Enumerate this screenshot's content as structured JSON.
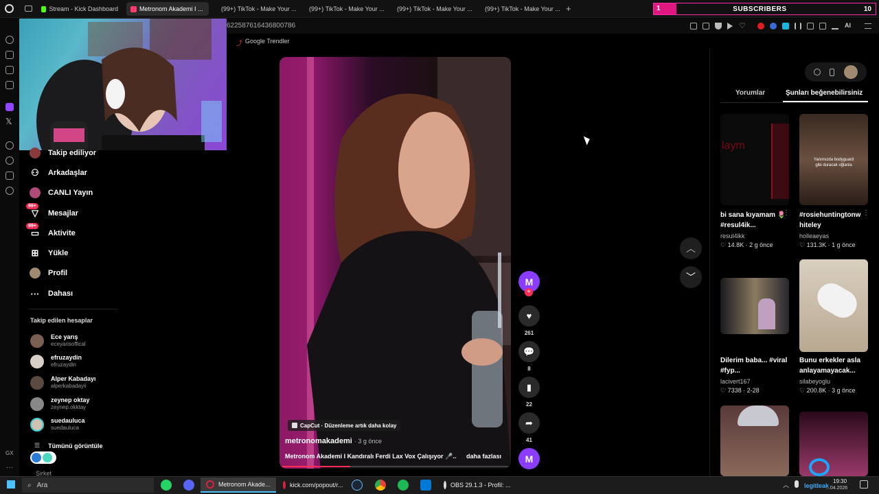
{
  "browser": {
    "tabs": [
      {
        "label": "Stream - Kick Dashboard",
        "color": "#53fc18"
      },
      {
        "label": "Metronom Akademi I ...",
        "color": "#ff3c6e",
        "active": true
      },
      {
        "label": "(99+) TikTok - Make Your ...",
        "color": "#ffffff"
      },
      {
        "label": "(99+) TikTok - Make Your ...",
        "color": "#ffffff"
      },
      {
        "label": "(99+) TikTok - Make Your ...",
        "color": "#ffffff"
      },
      {
        "label": "(99+) TikTok - Make Your ...",
        "color": "#ffffff"
      }
    ],
    "new_tab": "+",
    "url_fragment": "622587616436800786",
    "ai_label": "AI"
  },
  "subscribers_widget": {
    "count": "1",
    "label": "SUBSCRIBERS",
    "goal": "10",
    "progress": 0.1,
    "bar_color": "#e0177e"
  },
  "page": {
    "trending_label": "Google Trendler",
    "nav": [
      {
        "label": "Takip ediliyor",
        "icon": "following-icon"
      },
      {
        "label": "Arkadaşlar",
        "icon": "friends-icon"
      },
      {
        "label": "CANLI Yayın",
        "icon": "live-icon"
      },
      {
        "label": "Mesajlar",
        "icon": "messages-icon",
        "badge": "99+"
      },
      {
        "label": "Aktivite",
        "icon": "activity-icon",
        "badge": "99+"
      },
      {
        "label": "Yükle",
        "icon": "upload-icon"
      },
      {
        "label": "Profil",
        "icon": "profile-icon"
      },
      {
        "label": "Dahası",
        "icon": "more-icon"
      }
    ],
    "followed_heading": "Takip edilen hesaplar",
    "followed_accounts": [
      {
        "name": "Ece yarış",
        "handle": "eceyarisoffical"
      },
      {
        "name": "efruzaydin",
        "handle": "efruzaydin"
      },
      {
        "name": "Alper Kabadayı",
        "handle": "alperkabadayii"
      },
      {
        "name": "zeynep oktay",
        "handle": "zeynep.okktay"
      },
      {
        "name": "suedauluca",
        "handle": "suedauluca"
      }
    ],
    "see_all": "Tümünü görüntüle",
    "company": "Şirket"
  },
  "video": {
    "capcut_label": "CapCut · Düzenleme artık daha kolay",
    "author": "metronomakademi",
    "time": "· 3 g önce",
    "caption": "Metronom Akademi I Kandıralı Ferdi Lax Vox Çalışıyor 🎤...",
    "more": "daha fazlası",
    "likes": "261",
    "comments": "8",
    "saves": "22",
    "shares": "41"
  },
  "right_panel": {
    "tabs": [
      "Yorumlar",
      "Şunları beğenebilirsiniz"
    ],
    "items": [
      {
        "title": "bi sana kıyamam 🌷 #resul4ik...",
        "user": "resul4ikk",
        "likes": "14.8K",
        "date": "2 g önce",
        "thumb_text": "laym"
      },
      {
        "title": "#rosiehuntingtonw hiteley",
        "user": "holleaeyas",
        "likes": "131.3K",
        "date": "1 g önce",
        "thumb_text": "Yanımızda bodyguard gibi duracak oğlanla"
      },
      {
        "title": "Dilerim baba... #viral #fyp...",
        "user": "lacivert167",
        "likes": "7338",
        "date": "2-28",
        "thumb_text": ""
      },
      {
        "title": "Bunu erkekler asla anlayamayacak...",
        "user": "silabeyoglu",
        "likes": "200.8K",
        "date": "3 g önce",
        "thumb_text": ""
      }
    ]
  },
  "taskbar": {
    "search_placeholder": "Ara",
    "tasks": [
      "Metronom Akade...",
      "kick.com/popout/r...",
      "OBS 29.1.3 - Profil: ..."
    ],
    "time": "19:30",
    "date": "...04.2026",
    "watermark": "legitleak"
  },
  "cursor": {
    "visible": true
  }
}
